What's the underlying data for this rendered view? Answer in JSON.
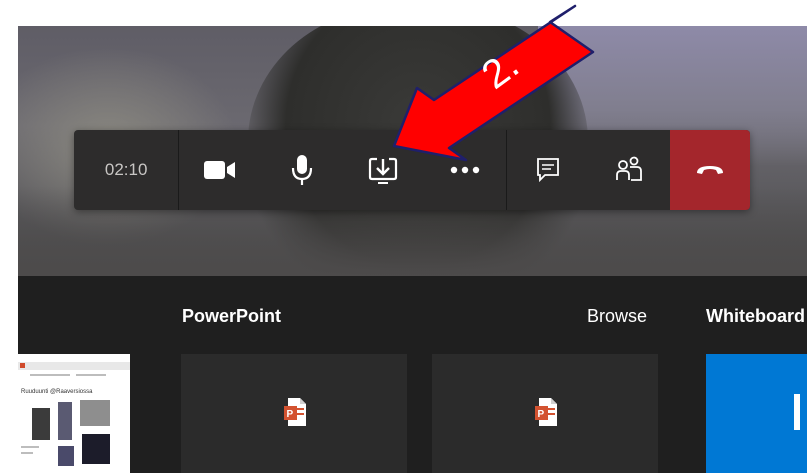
{
  "call": {
    "timer": "02:10",
    "buttons": [
      {
        "name": "camera",
        "icon": "video-camera-icon"
      },
      {
        "name": "microphone",
        "icon": "microphone-icon"
      },
      {
        "name": "share",
        "icon": "share-tray-icon"
      },
      {
        "name": "more",
        "icon": "more-dots-icon"
      },
      {
        "name": "chat",
        "icon": "chat-icon"
      },
      {
        "name": "participants",
        "icon": "people-icon"
      },
      {
        "name": "hang-up",
        "icon": "phone-hangup-icon"
      }
    ],
    "colors": {
      "toolbar": "#2d2c2c",
      "hangup": "#a4262c"
    }
  },
  "annotation": {
    "label": "2.",
    "color": "#ff0000"
  },
  "share_tray": {
    "powerpoint_title": "PowerPoint",
    "browse_label": "Browse",
    "whiteboard_title": "Whiteboard",
    "thumbnail_text": "Ruuduunti @Raaversiossa",
    "colors": {
      "panel": "#1f1f1f",
      "whiteboard": "#0078d4"
    }
  }
}
